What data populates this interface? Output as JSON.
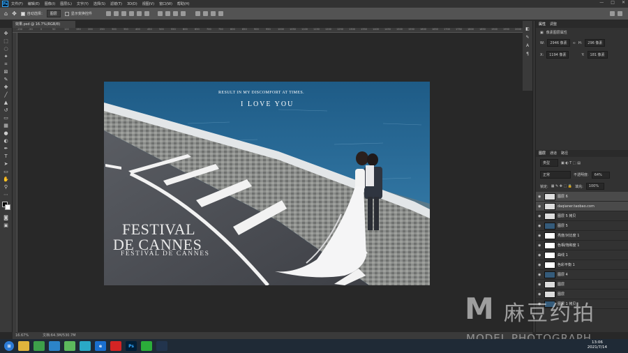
{
  "menu": [
    "文件(F)",
    "编辑(E)",
    "图像(I)",
    "图层(L)",
    "文字(Y)",
    "选择(S)",
    "滤镜(T)",
    "3D(D)",
    "视图(V)",
    "窗口(W)",
    "帮助(H)"
  ],
  "options": {
    "auto_select": "自动选择：",
    "layer_dropdown": "图层",
    "show_transform": "显示变换控件"
  },
  "doc_tab": "效果.psd @ 16.7%(RGB/8)",
  "ruler_ticks": [
    "-150",
    "-50",
    "0",
    "50",
    "100",
    "150",
    "200",
    "250",
    "300",
    "350",
    "400",
    "450",
    "500",
    "550",
    "600",
    "650",
    "700",
    "750",
    "800",
    "850",
    "900",
    "950",
    "1000",
    "1050",
    "1100",
    "1150",
    "1200",
    "1250",
    "1300",
    "1350",
    "1400",
    "1450",
    "1500",
    "1550",
    "1600",
    "1650",
    "1700",
    "1750",
    "1800",
    "1850",
    "1900",
    "1950",
    "2000"
  ],
  "photo": {
    "tagline": "RESULT IN MY DISCOMFORT AT TIMES.",
    "title": "I LOVE YOU",
    "festival_line1": "FESTIVAL",
    "festival_line2": "DE CANNES",
    "festival_line3": "FESTIVAL DE CANNES"
  },
  "status": {
    "zoom": "16.67%",
    "doc_size": "文档:64.3M/530.7M"
  },
  "properties": {
    "tab_active": "属性",
    "tab_other": "调整",
    "section": "像素图层属性",
    "w_label": "W:",
    "w_value": "2946 像素",
    "h_label": "H:",
    "h_value": "296 像素",
    "x_label": "X:",
    "x_value": "1194 像素",
    "y_label": "Y:",
    "y_value": "181 像素"
  },
  "layers_panel": {
    "tabs": [
      "图层",
      "通道",
      "路径"
    ],
    "kind": "类型",
    "blend": "正常",
    "opacity_label": "不透明度:",
    "opacity": "64%",
    "lock_label": "锁定:",
    "fill_label": "填充:",
    "fill": "100%",
    "items": [
      {
        "name": "图层 6",
        "selected": true
      },
      {
        "name": "daqianer.taobao.com",
        "selected": true
      },
      {
        "name": "图层 5 拷贝",
        "selected": false
      },
      {
        "name": "图层 5",
        "selected": false
      },
      {
        "name": "亮度/对比度 1",
        "selected": false
      },
      {
        "name": "色相/饱和度 1",
        "selected": false
      },
      {
        "name": "曲线 1",
        "selected": false
      },
      {
        "name": "色彩平衡 1",
        "selected": false
      },
      {
        "name": "图层 4",
        "selected": false
      },
      {
        "name": "图层",
        "selected": false
      },
      {
        "name": "图层",
        "selected": false
      },
      {
        "name": "图层 1 拷贝",
        "selected": false
      }
    ]
  },
  "taskbar": {
    "time": "13:06",
    "date": "2021/7/14"
  },
  "watermark": {
    "m": "M",
    "cn": "麻豆约拍",
    "sub": "MODEL PHOTOGRAPH"
  },
  "colors": {
    "accent": "#31a8ff",
    "water": "#2c6a95",
    "road": "#4c4e54"
  },
  "icons": [
    "ps-logo-icon",
    "move-icon",
    "marquee-icon",
    "lasso-icon",
    "wand-icon",
    "crop-icon",
    "eyedropper-icon",
    "brush-icon",
    "stamp-icon",
    "eraser-icon",
    "gradient-icon",
    "pen-icon",
    "text-icon",
    "hand-icon",
    "zoom-icon",
    "eye-icon"
  ]
}
